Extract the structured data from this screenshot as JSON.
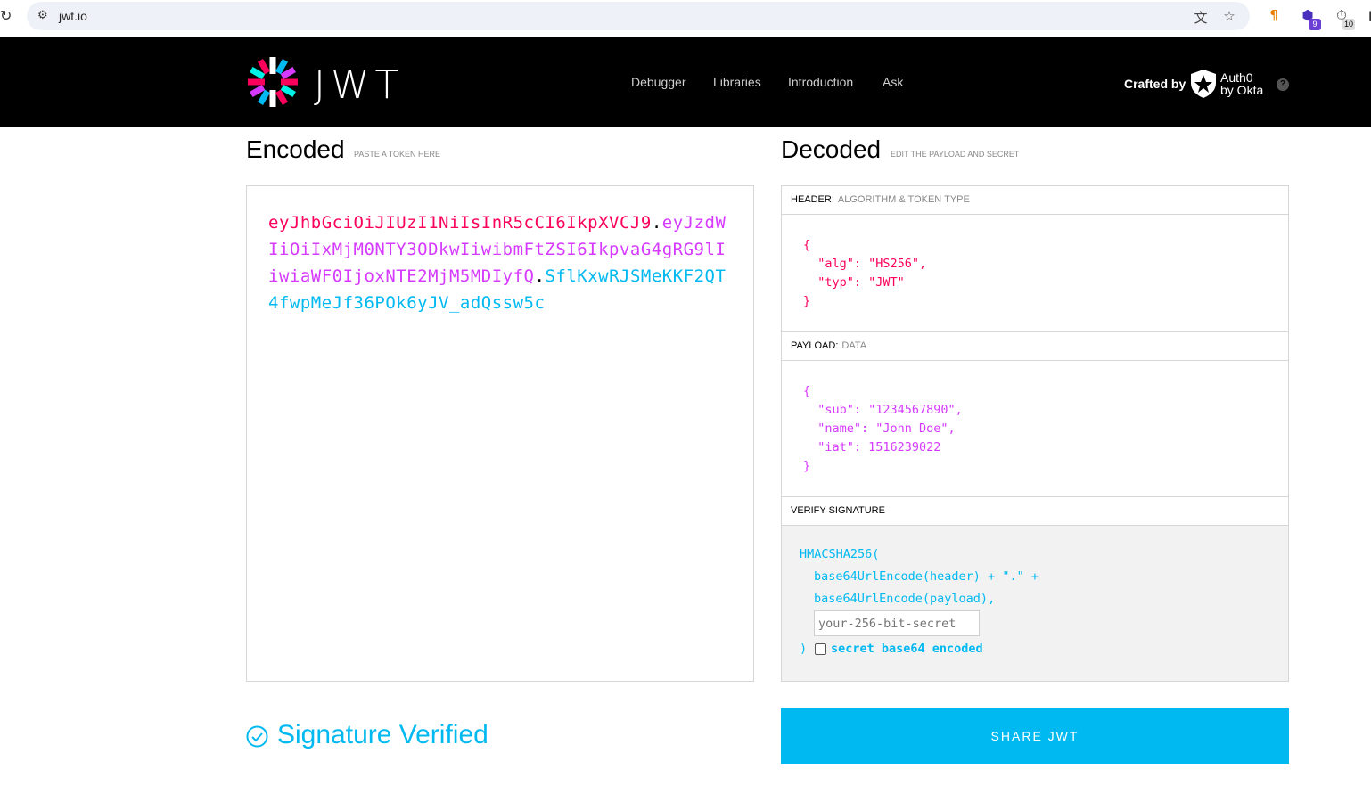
{
  "browser": {
    "url": "jwt.io",
    "icons": {
      "reload": "reload-icon",
      "site_settings": "tune-icon",
      "translate": "translate-icon",
      "bookmark": "star-icon"
    },
    "extensions": [
      {
        "name": "paragraph-extension-icon",
        "glyph": "¶",
        "badge": ""
      },
      {
        "name": "shield-extension-icon",
        "glyph": "⬢",
        "badge": "9"
      },
      {
        "name": "timer-extension-icon",
        "glyph": "⏱",
        "badge": "10"
      }
    ]
  },
  "header": {
    "logo_text": "JWT",
    "nav": [
      "Debugger",
      "Libraries",
      "Introduction",
      "Ask"
    ],
    "crafted_by": "Crafted by",
    "brand_line1": "Auth0",
    "brand_line2": "by Okta",
    "help": "?"
  },
  "encoded": {
    "title": "Encoded",
    "subtitle": "PASTE A TOKEN HERE",
    "token_header": "eyJhbGciOiJIUzI1NiIsInR5cCI6IkpXVCJ9",
    "token_payload": "eyJzdWIiOiIxMjM0NTY3ODkwIiwibmFtZSI6IkpvaG4gRG9lIiwiaWF0IjoxNTE2MjM5MDIyfQ",
    "token_signature": "SflKxwRJSMeKKF2QT4fwpMeJf36POk6yJV_adQssw5c",
    "dot": "."
  },
  "decoded": {
    "title": "Decoded",
    "subtitle": "EDIT THE PAYLOAD AND SECRET",
    "header_label": "HEADER:",
    "header_desc": "ALGORITHM & TOKEN TYPE",
    "header_json": "{\n  \"alg\": \"HS256\",\n  \"typ\": \"JWT\"\n}",
    "payload_label": "PAYLOAD:",
    "payload_desc": "DATA",
    "payload_json": "{\n  \"sub\": \"1234567890\",\n  \"name\": \"John Doe\",\n  \"iat\": 1516239022\n}",
    "verify_label": "VERIFY SIGNATURE",
    "verify_fn": "HMACSHA256(",
    "verify_line1": "base64UrlEncode(header) + \".\" +",
    "verify_line2": "base64UrlEncode(payload),",
    "secret_placeholder": "your-256-bit-secret",
    "close_paren": ")",
    "b64_label": "secret base64 encoded"
  },
  "footer": {
    "verified_text": "Signature Verified",
    "share_label": "SHARE JWT"
  },
  "colors": {
    "header_red": "#fb015b",
    "payload_purple": "#d63aff",
    "signature_blue": "#00b9f1"
  }
}
